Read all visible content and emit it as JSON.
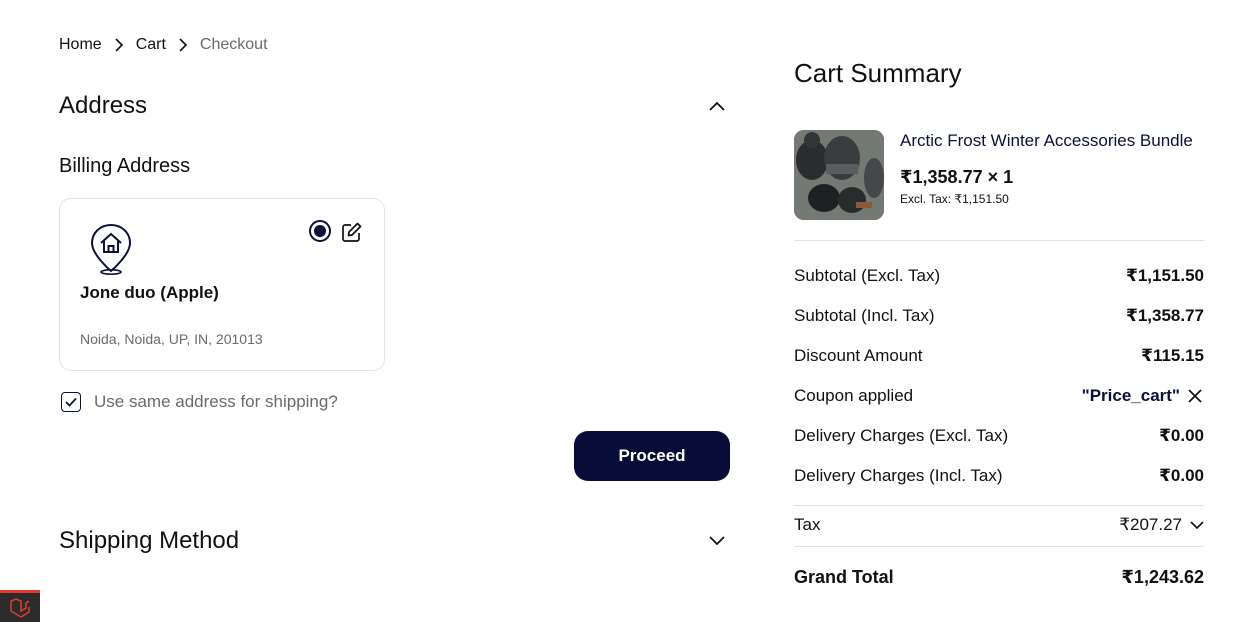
{
  "breadcrumb": {
    "home": "Home",
    "cart": "Cart",
    "checkout": "Checkout"
  },
  "address_section": {
    "title": "Address",
    "billing_title": "Billing Address",
    "card": {
      "name": "Jone duo (Apple)",
      "address": "Noida, Noida, UP, IN, 201013",
      "selected": true
    },
    "same_address_label": "Use same address for shipping?",
    "same_address_checked": true,
    "proceed_label": "Proceed"
  },
  "shipping_section": {
    "title": "Shipping Method"
  },
  "cart_summary": {
    "title": "Cart Summary",
    "product": {
      "name": "Arctic Frost Winter Accessories Bundle",
      "price_qty": "₹1,358.77 × 1",
      "excl_tax": "Excl. Tax: ₹1,151.50"
    },
    "rows": [
      {
        "label": "Subtotal (Excl. Tax)",
        "value": "₹1,151.50"
      },
      {
        "label": "Subtotal (Incl. Tax)",
        "value": "₹1,358.77"
      },
      {
        "label": "Discount Amount",
        "value": "₹115.15"
      },
      {
        "label": "Coupon applied",
        "value": "\"Price_cart\""
      },
      {
        "label": "Delivery Charges (Excl. Tax)",
        "value": "₹0.00"
      },
      {
        "label": "Delivery Charges (Incl. Tax)",
        "value": "₹0.00"
      }
    ],
    "tax": {
      "label": "Tax",
      "value": "₹207.27"
    },
    "grand_total": {
      "label": "Grand Total",
      "value": "₹1,243.62"
    }
  },
  "colors": {
    "primary": "#070d36",
    "muted_text": "#6b6b6b",
    "border": "#e5e5e5"
  },
  "icons": [
    "chevron-right-icon",
    "chevron-up-icon",
    "chevron-down-icon",
    "home-location-icon",
    "edit-icon",
    "check-icon",
    "close-icon",
    "laravel-logo-icon"
  ]
}
